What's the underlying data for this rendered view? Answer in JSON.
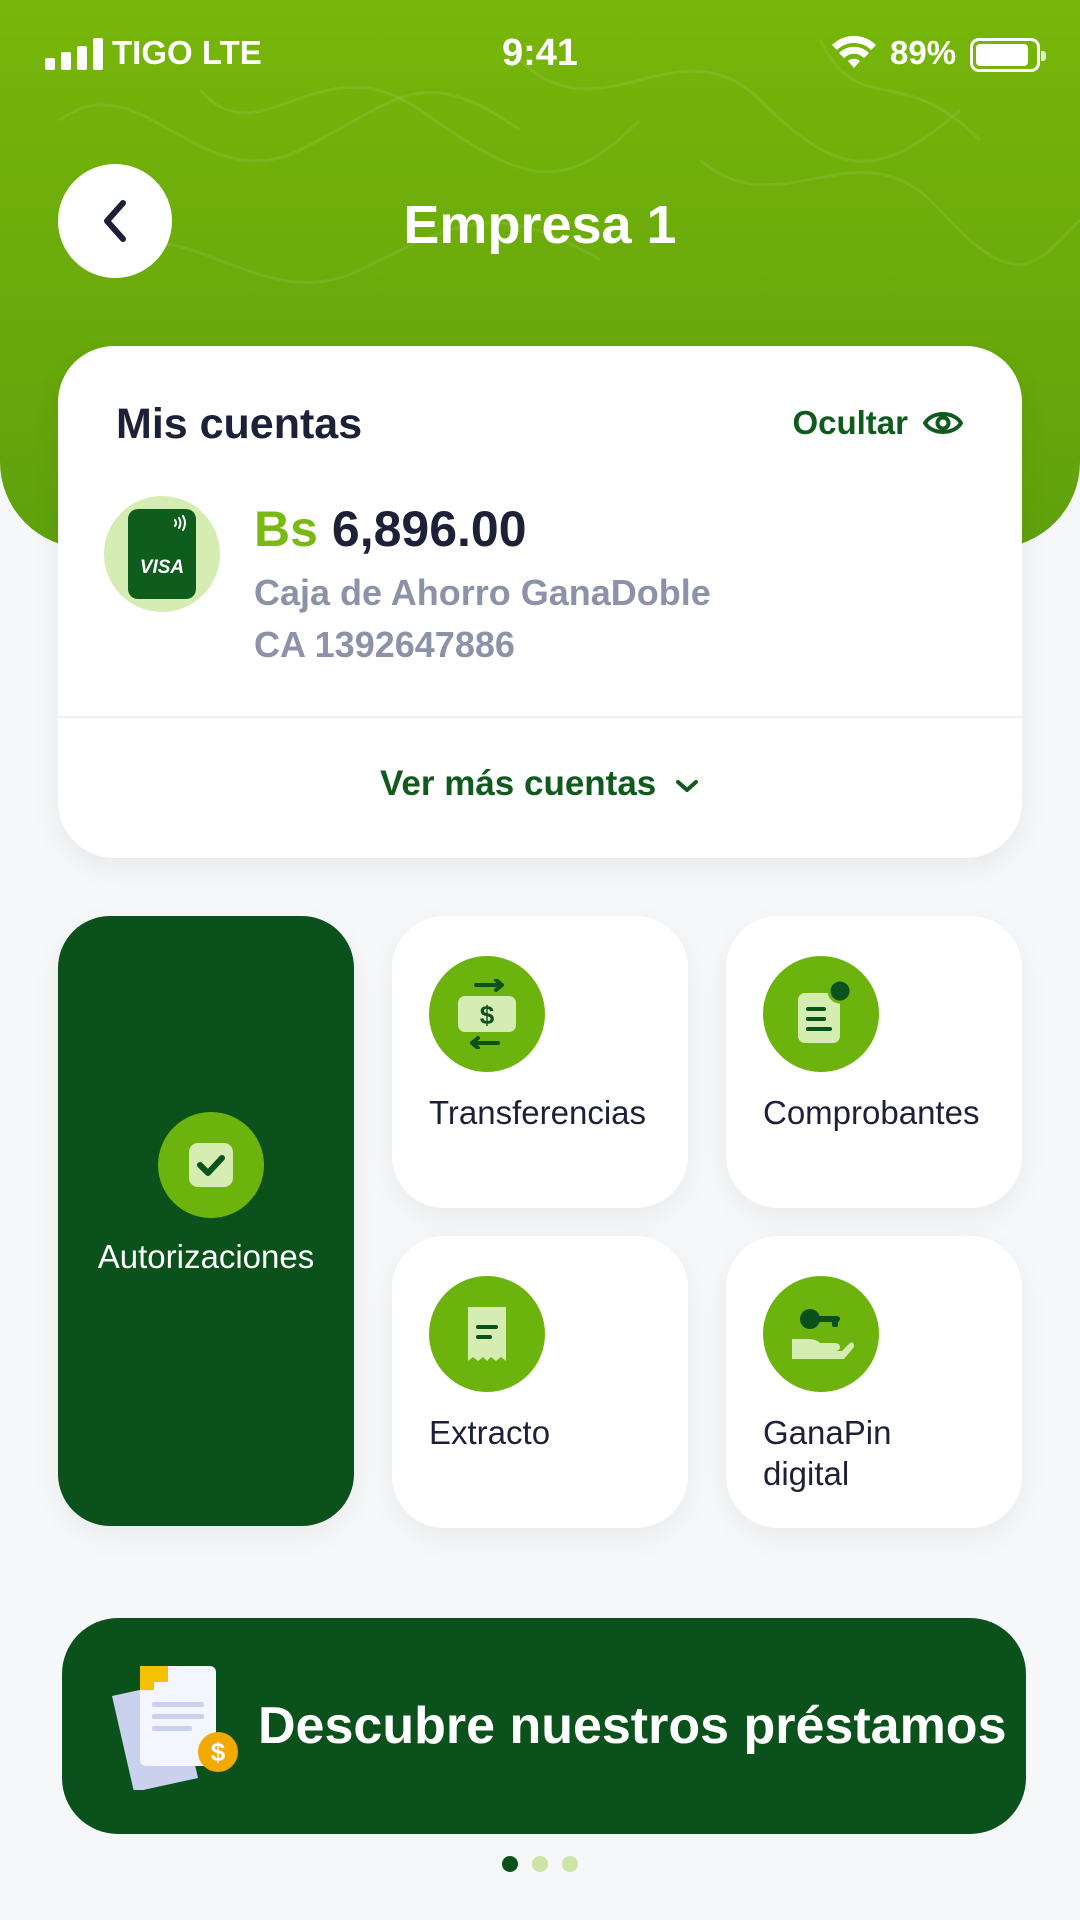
{
  "status_bar": {
    "carrier": "TIGO LTE",
    "time": "9:41",
    "battery": "89%",
    "battery_level": 0.89
  },
  "header": {
    "title": "Empresa 1",
    "back_icon": "chevron-left-icon"
  },
  "accounts": {
    "title": "Mis cuentas",
    "hide_label": "Ocultar",
    "hide_icon": "eye-icon",
    "card_brand": "VISA",
    "currency": "Bs",
    "balance": "6,896.00",
    "account_type": "Caja de Ahorro GanaDoble",
    "account_number": "CA 1392647886",
    "more_label": "Ver más cuentas"
  },
  "actions": [
    {
      "label": "Autorizaciones",
      "icon": "check-square-icon"
    },
    {
      "label": "Transferencias",
      "icon": "transfer-money-icon"
    },
    {
      "label": "Comprobantes",
      "icon": "receipt-notification-icon"
    },
    {
      "label": "Extracto",
      "icon": "statement-icon"
    },
    {
      "label_line1": "GanaPin",
      "label_line2": "digital",
      "icon": "key-hand-icon"
    }
  ],
  "banner": {
    "text": "Descubre nuestros préstamos",
    "icon": "loan-document-icon"
  },
  "pagination": {
    "pages": 3,
    "active": 1
  },
  "colors": {
    "brand_green": "#6db30e",
    "dark_green": "#0a511b",
    "text_dark": "#1d2138",
    "text_muted": "#8c93a8"
  }
}
